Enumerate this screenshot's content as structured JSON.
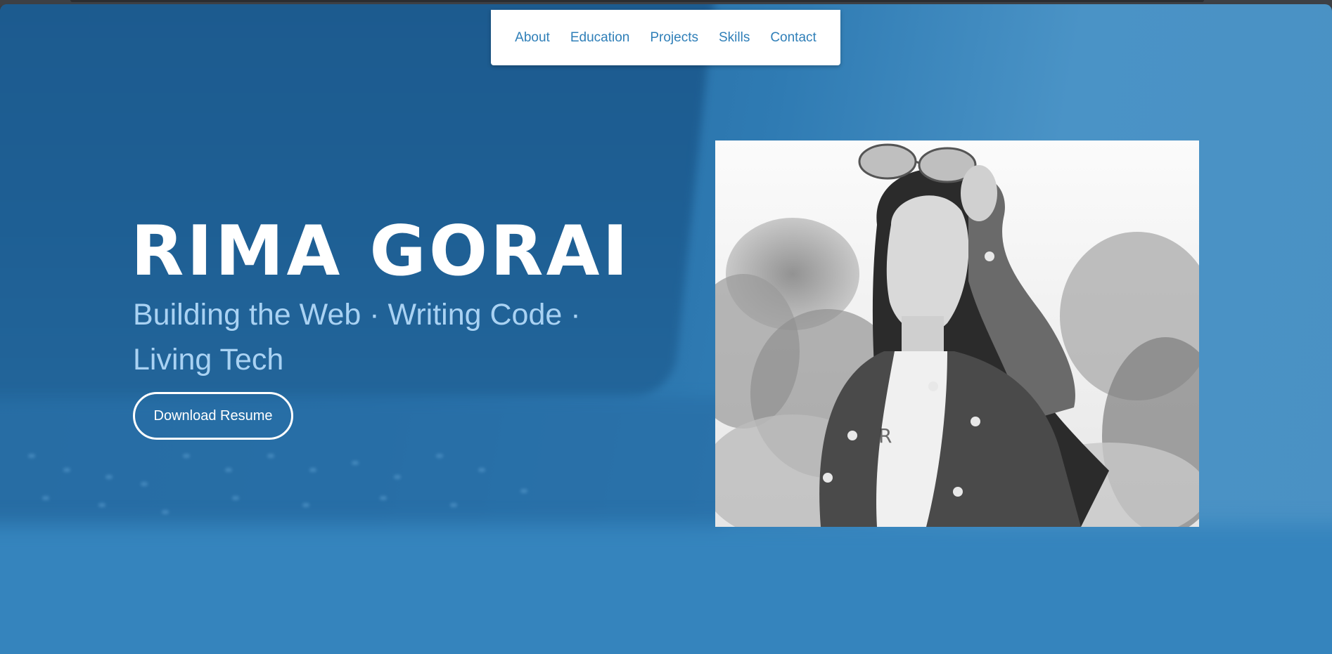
{
  "nav": {
    "items": [
      {
        "label": "About"
      },
      {
        "label": "Education"
      },
      {
        "label": "Projects"
      },
      {
        "label": "Skills"
      },
      {
        "label": "Contact"
      }
    ]
  },
  "hero": {
    "name": "RIMA GORAI",
    "tagline": "Building the Web · Writing Code · Living Tech",
    "resume_button": "Download Resume",
    "photo_icon": "portrait-photo-icon"
  },
  "colors": {
    "accent": "#2f7fb8",
    "hero_bg": "#2268a0",
    "tagline": "#a9d2f3",
    "name": "#ffffff"
  }
}
